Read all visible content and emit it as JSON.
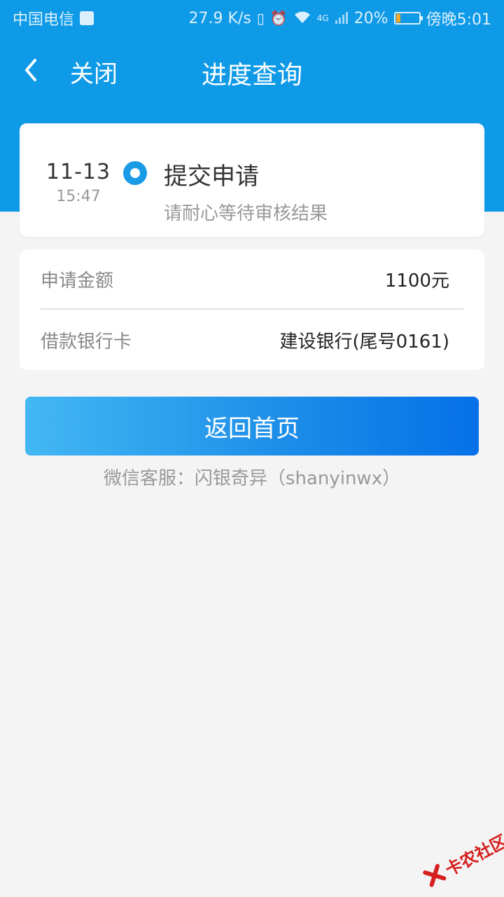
{
  "status_bar": {
    "carrier": "中国电信",
    "speed": "27.9 K/s",
    "network": "4G",
    "battery": "20%",
    "battery_level": 0.2,
    "time": "傍晚5:01"
  },
  "nav": {
    "close_label": "关闭",
    "title": "进度查询"
  },
  "progress": {
    "date": "11-13",
    "time": "15:47",
    "step": "提交申请",
    "description": "请耐心等待审核结果"
  },
  "info": {
    "amount_label": "申请金额",
    "amount_value": "1100元",
    "card_label": "借款银行卡",
    "card_value": "建设银行(尾号0161)"
  },
  "actions": {
    "home_label": "返回首页"
  },
  "service_text": "微信客服：闪银奇异（shanyinwx）",
  "watermark": {
    "text": "卡农社区"
  },
  "colors": {
    "header": "#0f9ae8",
    "accent": "#1a9be6",
    "button_start": "#44b7f4",
    "button_end": "#0670e8",
    "watermark": "#d61f1f"
  }
}
